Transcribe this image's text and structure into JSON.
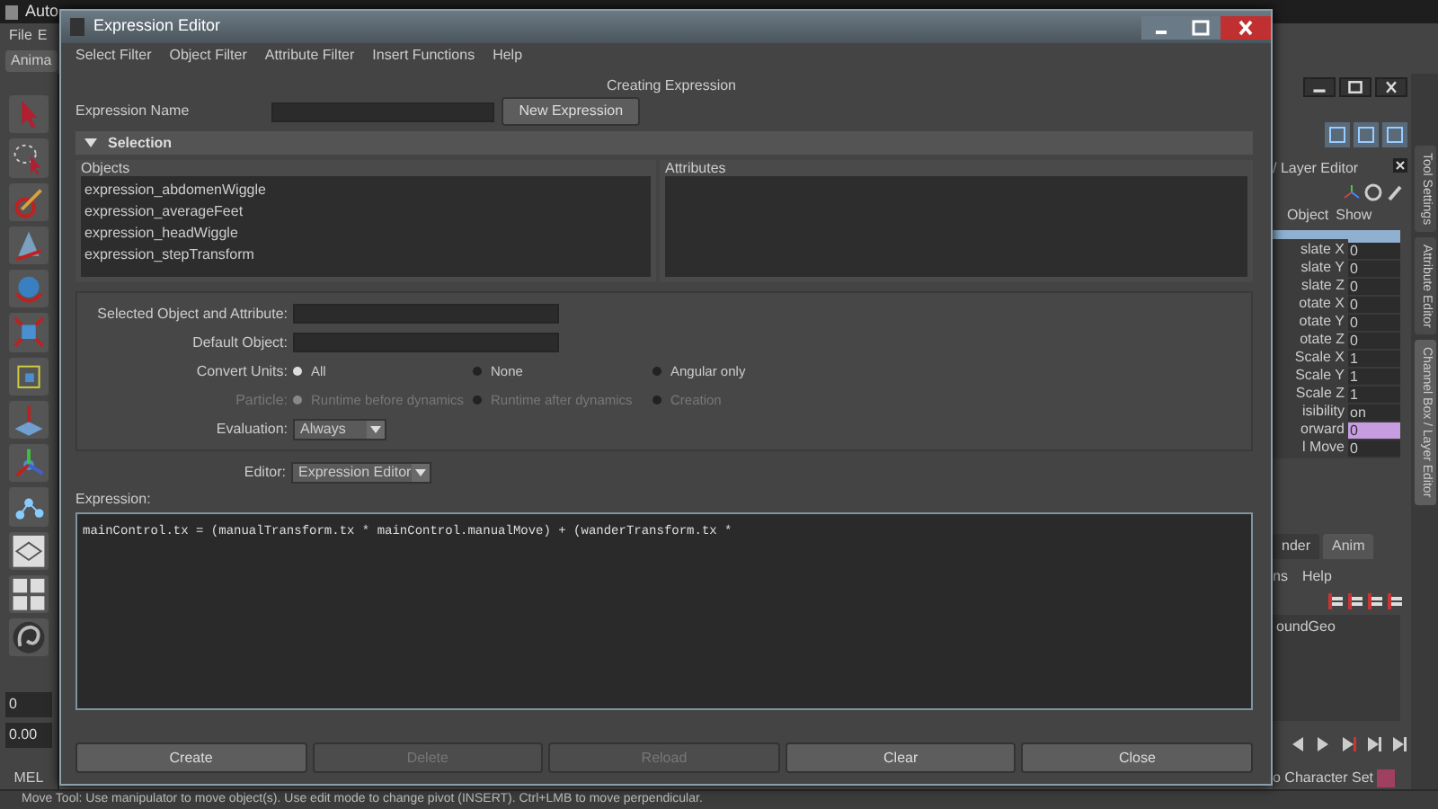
{
  "app": {
    "title": "Auto",
    "menus": [
      "File",
      "E"
    ],
    "shelf_tab": "Anima",
    "frame_field": "0",
    "time_field": "0.00",
    "command_language": "MEL",
    "channel_box": {
      "header": "/ Layer Editor",
      "menus": [
        "Object",
        "Show"
      ],
      "channels": [
        {
          "name": "slate X",
          "value": "0",
          "selected": false
        },
        {
          "name": "slate Y",
          "value": "0",
          "selected": false
        },
        {
          "name": "slate Z",
          "value": "0",
          "selected": false
        },
        {
          "name": "otate X",
          "value": "0",
          "selected": false
        },
        {
          "name": "otate Y",
          "value": "0",
          "selected": false
        },
        {
          "name": "otate Z",
          "value": "0",
          "selected": false
        },
        {
          "name": "Scale X",
          "value": "1",
          "selected": false
        },
        {
          "name": "Scale Y",
          "value": "1",
          "selected": false
        },
        {
          "name": "Scale Z",
          "value": "1",
          "selected": false
        },
        {
          "name": "isibility",
          "value": "on",
          "selected": false
        },
        {
          "name": "orward",
          "value": "0",
          "selected": true
        },
        {
          "name": "l Move",
          "value": "0",
          "selected": false
        }
      ]
    },
    "layer_tabs": [
      {
        "label": "nder",
        "selected": false
      },
      {
        "label": "Anim",
        "selected": true
      }
    ],
    "layer_menus": [
      "ns",
      "Help"
    ],
    "layers": [
      "oundGeo"
    ],
    "character_set": "o Character Set",
    "side_tabs": [
      {
        "label": "Tool Settings",
        "selected": false
      },
      {
        "label": "Attribute Editor",
        "selected": false
      },
      {
        "label": "Channel Box / Layer Editor",
        "selected": true
      }
    ],
    "status_bar": "Move Tool: Use manipulator to move object(s). Use edit mode to change pivot (INSERT).  Ctrl+LMB to move perpendicular."
  },
  "dialog": {
    "title": "Expression Editor",
    "menus": [
      "Select Filter",
      "Object Filter",
      "Attribute Filter",
      "Insert Functions",
      "Help"
    ],
    "mode": "Creating Expression",
    "name_label": "Expression Name",
    "new_button": "New Expression",
    "section": {
      "title": "Selection",
      "expanded": true
    },
    "objects": {
      "header": "Objects",
      "items": [
        "expression_abdomenWiggle",
        "expression_averageFeet",
        "expression_headWiggle",
        "expression_stepTransform"
      ]
    },
    "attributes": {
      "header": "Attributes"
    },
    "fields": [
      {
        "label": "Selected Object and Attribute:"
      },
      {
        "label": "Default Object:"
      }
    ],
    "radio_groups": [
      {
        "label": "Convert Units:",
        "disabled": false,
        "options": [
          {
            "label": "All",
            "selected": true
          },
          {
            "label": "None",
            "selected": false
          },
          {
            "label": "Angular only",
            "selected": false
          }
        ]
      },
      {
        "label": "Particle:",
        "disabled": true,
        "options": [
          {
            "label": "Runtime before dynamics",
            "selected": true
          },
          {
            "label": "Runtime after dynamics",
            "selected": false
          },
          {
            "label": "Creation",
            "selected": false
          }
        ]
      }
    ],
    "evaluation": {
      "label": "Evaluation:",
      "value": "Always"
    },
    "editor": {
      "label": "Editor:",
      "value": "Expression Editor"
    },
    "expression": {
      "label": "Expression:",
      "value": "mainControl.tx = (manualTransform.tx * mainControl.manualMove) + (wanderTransform.tx *"
    },
    "buttons": [
      {
        "label": "Create",
        "disabled": false
      },
      {
        "label": "Delete",
        "disabled": true
      },
      {
        "label": "Reload",
        "disabled": true
      },
      {
        "label": "Clear",
        "disabled": false
      },
      {
        "label": "Close",
        "disabled": false
      }
    ]
  }
}
